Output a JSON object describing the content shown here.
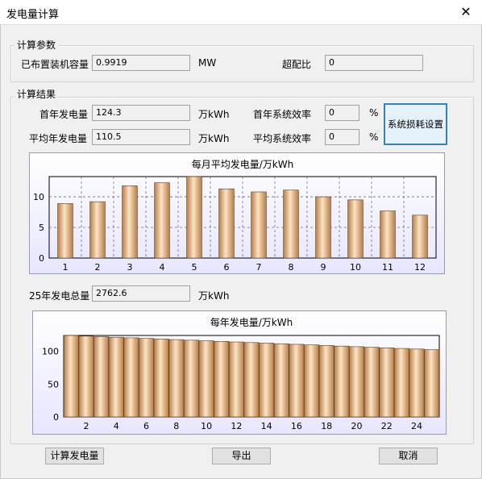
{
  "window": {
    "title": "发电量计算",
    "close_glyph": "✕"
  },
  "params": {
    "group_label": "计算参数",
    "capacity_label": "已布置装机容量",
    "capacity_value": "0.9919",
    "capacity_unit": "MW",
    "ratio_label": "超配比",
    "ratio_value": "0"
  },
  "results": {
    "group_label": "计算结果",
    "first_year_label": "首年发电量",
    "first_year_value": "124.3",
    "first_year_unit": "万kWh",
    "avg_year_label": "平均年发电量",
    "avg_year_value": "110.5",
    "avg_year_unit": "万kWh",
    "first_eff_label": "首年系统效率",
    "first_eff_value": "0",
    "first_eff_unit": "%",
    "avg_eff_label": "平均系统效率",
    "avg_eff_value": "0",
    "avg_eff_unit": "%",
    "loss_button": "系统损耗设置",
    "total_label": "25年发电总量",
    "total_value": "2762.6",
    "total_unit": "万kWh"
  },
  "buttons": {
    "calc": "计算发电量",
    "export": "导出",
    "cancel": "取消"
  },
  "colors": {
    "bar_light": "#fde3c6",
    "bar_dark": "#b77e47",
    "grid": "#6a6a9a"
  },
  "chart_data": [
    {
      "type": "bar",
      "title": "每月平均发电量/万kWh",
      "categories": [
        "1",
        "2",
        "3",
        "4",
        "5",
        "6",
        "7",
        "8",
        "9",
        "10",
        "11",
        "12"
      ],
      "values": [
        8.9,
        9.2,
        11.8,
        12.3,
        13.3,
        11.3,
        10.8,
        11.1,
        10.0,
        9.5,
        7.7,
        7.0
      ],
      "yticks": [
        0,
        5,
        10
      ],
      "ylim": [
        0,
        13.3
      ],
      "grid": true
    },
    {
      "type": "bar",
      "title": "每年发电量/万kWh",
      "categories": [
        "1",
        "2",
        "3",
        "4",
        "5",
        "6",
        "7",
        "8",
        "9",
        "10",
        "11",
        "12",
        "13",
        "14",
        "15",
        "16",
        "17",
        "18",
        "19",
        "20",
        "21",
        "22",
        "23",
        "24",
        "25"
      ],
      "tick_labels": [
        "2",
        "4",
        "6",
        "8",
        "10",
        "12",
        "14",
        "16",
        "18",
        "20",
        "22",
        "24"
      ],
      "values": [
        124.3,
        123.4,
        122.5,
        121.6,
        120.7,
        119.8,
        118.9,
        118.0,
        117.1,
        116.2,
        115.3,
        114.4,
        113.5,
        112.6,
        111.7,
        110.8,
        109.9,
        109.0,
        108.1,
        107.2,
        106.3,
        105.4,
        104.5,
        103.6,
        102.7
      ],
      "yticks": [
        0,
        50,
        100
      ],
      "ylim": [
        0,
        124.3
      ],
      "grid": true
    }
  ]
}
